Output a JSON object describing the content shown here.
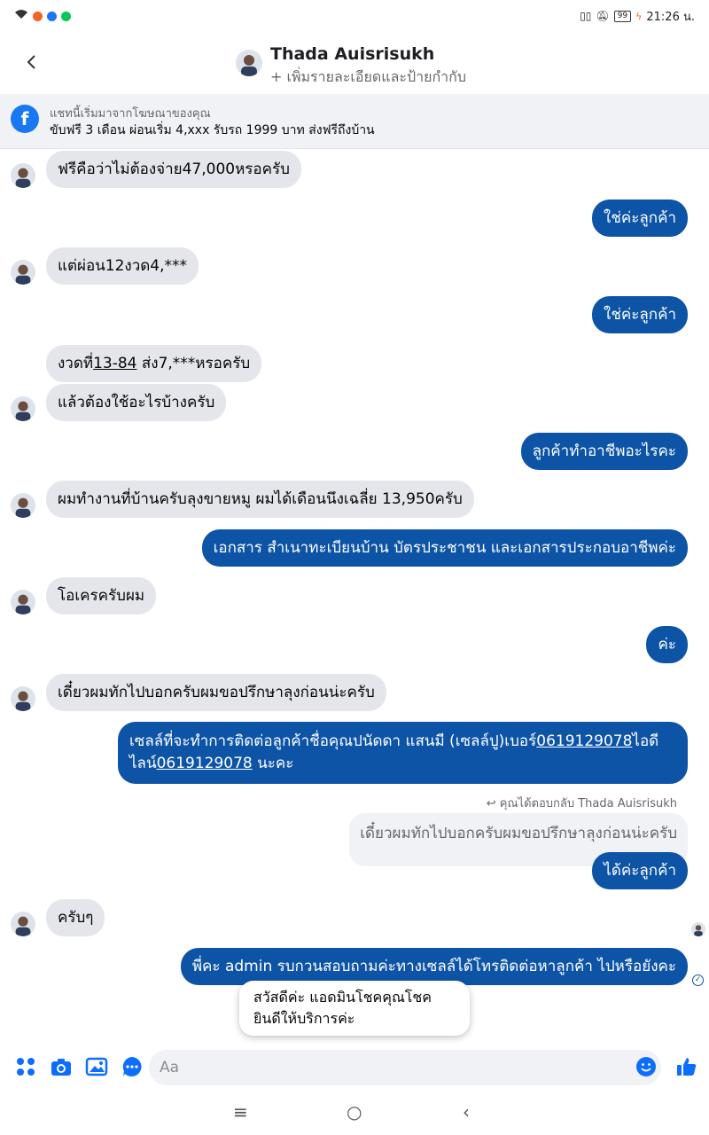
{
  "status_bar": {
    "time": "21:26 น.",
    "battery": "99"
  },
  "header": {
    "name": "Thada Auisrisukh",
    "subtitle": "+ เพิ่มรายละเอียดและป้ายกำกับ"
  },
  "ad_banner": {
    "line1": "แชทนี้เริ่มมาจากโฆษณาของคุณ",
    "line2": "ขับฟรี 3 เดือน ผ่อนเริ่ม 4,xxx  รับรถ 1999 บาท ส่งฟรีถึงบ้าน"
  },
  "messages": {
    "m1": "ฟรีคือว่าไม่ต้องจ่าย47,000หรอครับ",
    "m2": "ใช่ค่ะลูกค้า",
    "m3": "แต่ผ่อน12งวด4,***",
    "m4": "ใช่ค่ะลูกค้า",
    "m5_pre": "งวดที่",
    "m5_link": "13-84",
    "m5_post": " ส่ง7,***หรอครับ",
    "m6": "แล้วต้องใช้อะไรบ้างครับ",
    "m7": "ลูกค้าทำอาชีพอะไรคะ",
    "m8": "ผมทำงานที่บ้านครับลุงขายหมู ผมได้เดือนนึงเฉลี่ย 13,950ครับ",
    "m9": "เอกสาร สำเนาทะเบียนบ้าน บัตรประชาชน และเอกสารประกอบอาชีพค่ะ",
    "m10": "โอเครครับผม",
    "m11": "ค่ะ",
    "m12": "เดี๋ยวผมทักไปบอกครับผมขอปรึกษาลุงก่อนน่ะครับ",
    "m13_a": "เซลล์ที่จะทำการติดต่อลูกค้าชื่อคุณปนัดดา แสนมี (เซลล์ปู)เบอร์",
    "m13_phone1": "0619129078",
    "m13_b": "ไอดีไลน์",
    "m13_phone2": "0619129078",
    "m13_c": " นะคะ",
    "reply_note": "คุณได้ตอบกลับ Thada Auisrisukh",
    "quoted": "เดี๋ยวผมทักไปบอกครับผมขอปรึกษาลุงก่อนน่ะครับ",
    "m14": "ได้ค่ะลูกค้า",
    "m15": "ครับๆ",
    "m16": "พี่คะ admin รบกวนสอบถามค่ะทางเซลล์ได้โทรติดต่อหาลูกค้า ไปหรือยังคะ"
  },
  "popup": {
    "line1": "สวัสดีค่ะ แอดมินโชคคุณโชค",
    "line2": "ยินดีให้บริการค่ะ"
  },
  "composer": {
    "placeholder": "Aa"
  },
  "colors": {
    "outgoing": "#0d54a7",
    "incoming": "#e4e6eb",
    "accent": "#1877f2"
  },
  "icons": [
    "back-arrow-icon",
    "facebook-icon",
    "apps-icon",
    "camera-icon",
    "gallery-icon",
    "sticker-icon",
    "emoji-icon",
    "like-icon",
    "menu-icon",
    "home-icon",
    "back-icon"
  ]
}
